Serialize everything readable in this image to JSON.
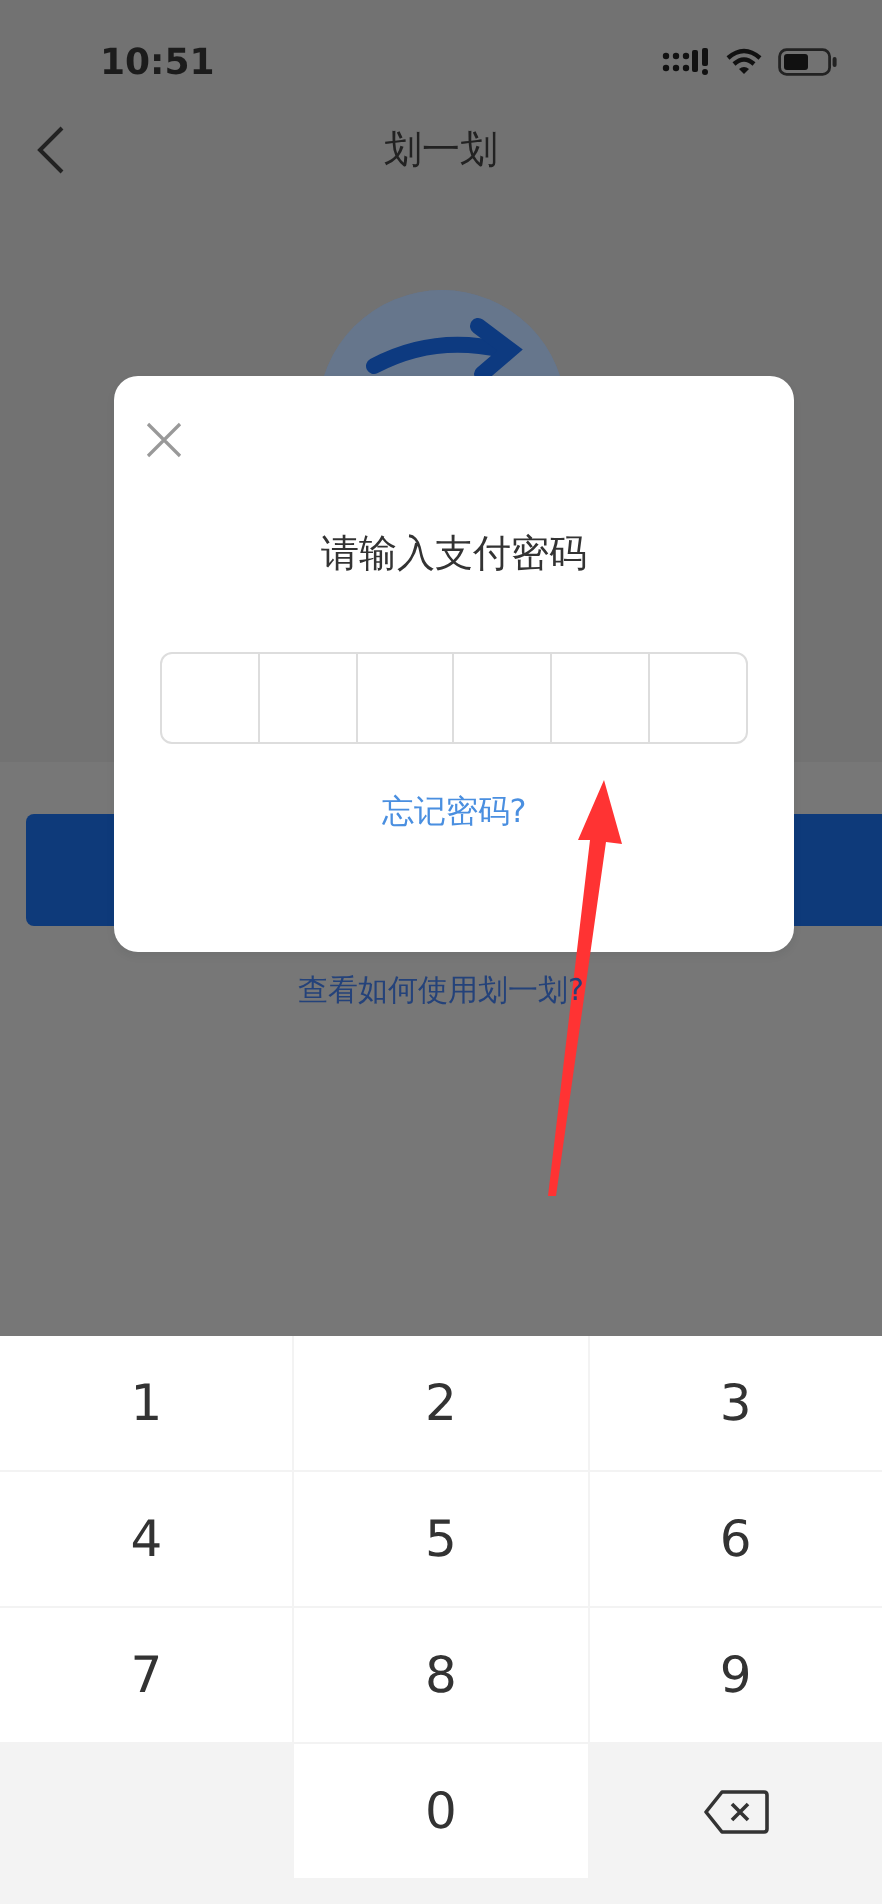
{
  "status_bar": {
    "time": "10:51"
  },
  "header": {
    "title": "划一划"
  },
  "page": {
    "help_link": "查看如何使用划一划?"
  },
  "dialog": {
    "title": "请输入支付密码",
    "cells": [
      {
        "filled": false
      },
      {
        "filled": false
      },
      {
        "filled": false
      },
      {
        "filled": false
      },
      {
        "filled": false
      },
      {
        "filled": false
      }
    ],
    "forgot_link": "忘记密码?"
  },
  "keypad": {
    "keys": [
      {
        "kind": "digit",
        "label": "1"
      },
      {
        "kind": "digit",
        "label": "2"
      },
      {
        "kind": "digit",
        "label": "3"
      },
      {
        "kind": "digit",
        "label": "4"
      },
      {
        "kind": "digit",
        "label": "5"
      },
      {
        "kind": "digit",
        "label": "6"
      },
      {
        "kind": "digit",
        "label": "7"
      },
      {
        "kind": "digit",
        "label": "8"
      },
      {
        "kind": "digit",
        "label": "9"
      },
      {
        "kind": "blank"
      },
      {
        "kind": "digit",
        "label": "0"
      },
      {
        "kind": "backspace"
      }
    ]
  }
}
